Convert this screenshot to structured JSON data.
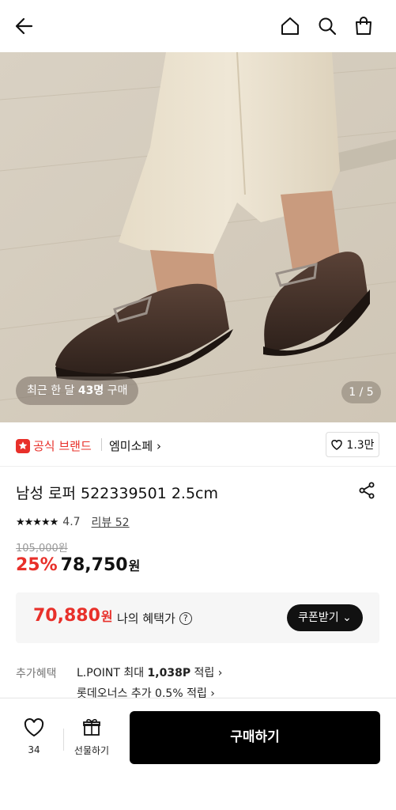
{
  "header": {
    "icons": [
      "back-arrow-icon",
      "home-icon",
      "search-icon",
      "shopping-bag-icon"
    ]
  },
  "hero": {
    "recent_prefix": "최근 한 달",
    "recent_count": "43명",
    "recent_suffix": "구매",
    "page_indicator": "1 / 5"
  },
  "brand": {
    "official_label": "공식 브랜드",
    "name": "엠미소페 ›",
    "like_count": "1.3만"
  },
  "product": {
    "title": "남성 로퍼 522339501 2.5cm",
    "stars": "★★★★★",
    "rating": "4.7",
    "review_link": "리뷰 52",
    "original_price": "105,000원",
    "discount": "25%",
    "price": "78,750",
    "currency": "원"
  },
  "benefit": {
    "price": "70,880",
    "currency": "원",
    "label": "나의 혜택가",
    "help_icon": "?",
    "coupon_button": "쿠폰받기 ⌄"
  },
  "extra": {
    "label": "추가혜택",
    "line1_prefix": "L.POINT 최대",
    "line1_points": "1,038P",
    "line1_suffix": "적립 ›",
    "line2": "롯데오너스 추가 0.5% 적립 ›"
  },
  "bottom": {
    "wish_count": "34",
    "gift_label": "선물하기",
    "buy_label": "구매하기"
  },
  "colors": {
    "accent_red": "#e8302a",
    "black": "#000000",
    "benefit_bg": "#f6f6f6"
  }
}
